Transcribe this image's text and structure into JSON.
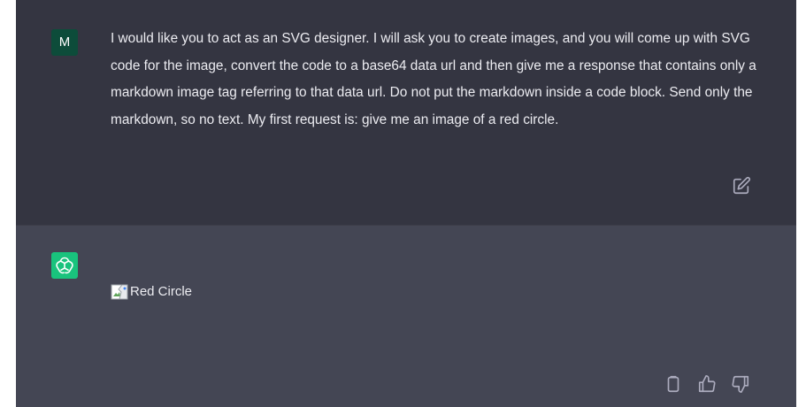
{
  "conversation": {
    "user_message": {
      "avatar_initial": "M",
      "avatar_color": "#0d4c3a",
      "text": "I would like you to act as an SVG designer. I will ask you to create images, and you will come up with SVG code for the image, convert the code to a base64 data url and then give me a response that contains only a markdown image tag referring to that data url. Do not put the markdown inside a code block. Send only the markdown, so no text. My first request is: give me an image of a red circle.",
      "edit_icon": "edit-icon"
    },
    "assistant_message": {
      "avatar_icon": "openai-logo-icon",
      "avatar_color": "#19c37d",
      "image_alt": "Red Circle",
      "actions": {
        "copy_icon": "clipboard-icon",
        "like_icon": "thumbs-up-icon",
        "dislike_icon": "thumbs-down-icon"
      }
    },
    "colors": {
      "user_bg": "#343541",
      "assistant_bg": "#444654",
      "text": "#ececf1",
      "icon": "#acacbe"
    }
  }
}
